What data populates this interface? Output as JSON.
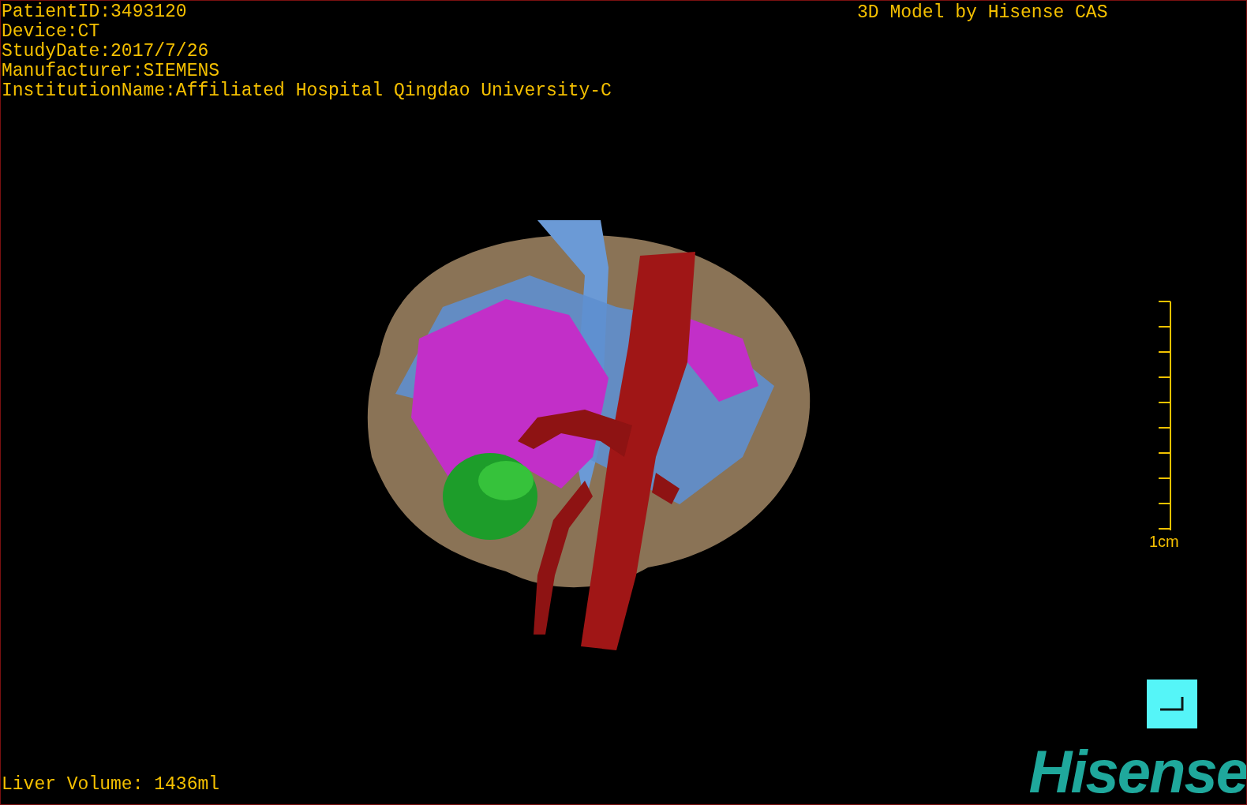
{
  "viewer": {
    "info_lines": [
      "PatientID:3493120",
      "Device:CT",
      "StudyDate:2017/7/26",
      "Manufacturer:SIEMENS",
      "InstitutionName:Affiliated Hospital Qingdao University-C"
    ],
    "title": "3D Model by Hisense CAS",
    "scale_label": "1cm",
    "volume": "Liver Volume: 1436ml",
    "logo": "Hisense"
  }
}
